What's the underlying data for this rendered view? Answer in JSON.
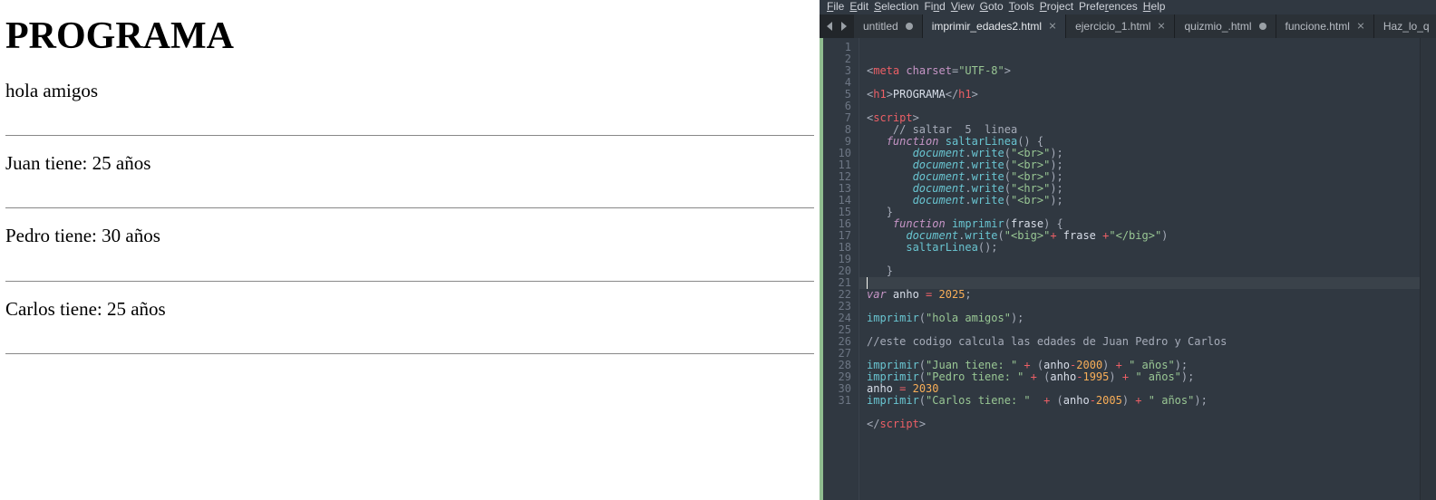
{
  "browser": {
    "heading": "PROGRAMA",
    "lines": [
      "hola amigos",
      "Juan tiene: 25 años",
      "Pedro tiene: 30 años",
      "Carlos tiene: 25 años"
    ]
  },
  "editor": {
    "menu": [
      "File",
      "Edit",
      "Selection",
      "Find",
      "View",
      "Goto",
      "Tools",
      "Project",
      "Preferences",
      "Help"
    ],
    "tabs": [
      {
        "label": "untitled",
        "dirty": true,
        "active": false
      },
      {
        "label": "imprimir_edades2.html",
        "dirty": false,
        "active": true
      },
      {
        "label": "ejercicio_1.html",
        "dirty": false,
        "active": false
      },
      {
        "label": "quizmio_.html",
        "dirty": true,
        "active": false
      },
      {
        "label": "funcione.html",
        "dirty": false,
        "active": false
      },
      {
        "label": "Haz_lo_q",
        "dirty": false,
        "active": false
      }
    ],
    "line_count": 31,
    "active_line": 21,
    "code_lines": [
      {
        "n": 1,
        "t": [
          [
            "pun",
            "<"
          ],
          [
            "tag",
            "meta"
          ],
          [
            "txt",
            " "
          ],
          [
            "attr",
            "charset"
          ],
          [
            "pun",
            "="
          ],
          [
            "str",
            "\"UTF-8\""
          ],
          [
            "pun",
            ">"
          ]
        ]
      },
      {
        "n": 2,
        "t": []
      },
      {
        "n": 3,
        "t": [
          [
            "pun",
            "<"
          ],
          [
            "tag",
            "h1"
          ],
          [
            "pun",
            ">"
          ],
          [
            "txt",
            "PROGRAMA"
          ],
          [
            "pun",
            "</"
          ],
          [
            "tag",
            "h1"
          ],
          [
            "pun",
            ">"
          ]
        ]
      },
      {
        "n": 4,
        "t": []
      },
      {
        "n": 5,
        "t": [
          [
            "pun",
            "<"
          ],
          [
            "tag",
            "script"
          ],
          [
            "pun",
            ">"
          ]
        ]
      },
      {
        "n": 6,
        "t": [
          [
            "txt",
            "    "
          ],
          [
            "cm",
            "// saltar  5  linea"
          ]
        ]
      },
      {
        "n": 7,
        "t": [
          [
            "txt",
            "   "
          ],
          [
            "kw",
            "function"
          ],
          [
            "txt",
            " "
          ],
          [
            "fn",
            "saltarLinea"
          ],
          [
            "pun",
            "() {"
          ]
        ]
      },
      {
        "n": 8,
        "t": [
          [
            "txt",
            "       "
          ],
          [
            "obj",
            "document"
          ],
          [
            "pun",
            "."
          ],
          [
            "fn",
            "write"
          ],
          [
            "pun",
            "("
          ],
          [
            "str",
            "\"<br>\""
          ],
          [
            "pun",
            ");"
          ]
        ]
      },
      {
        "n": 9,
        "t": [
          [
            "txt",
            "       "
          ],
          [
            "obj",
            "document"
          ],
          [
            "pun",
            "."
          ],
          [
            "fn",
            "write"
          ],
          [
            "pun",
            "("
          ],
          [
            "str",
            "\"<br>\""
          ],
          [
            "pun",
            ");"
          ]
        ]
      },
      {
        "n": 10,
        "t": [
          [
            "txt",
            "       "
          ],
          [
            "obj",
            "document"
          ],
          [
            "pun",
            "."
          ],
          [
            "fn",
            "write"
          ],
          [
            "pun",
            "("
          ],
          [
            "str",
            "\"<br>\""
          ],
          [
            "pun",
            ");"
          ]
        ]
      },
      {
        "n": 11,
        "t": [
          [
            "txt",
            "       "
          ],
          [
            "obj",
            "document"
          ],
          [
            "pun",
            "."
          ],
          [
            "fn",
            "write"
          ],
          [
            "pun",
            "("
          ],
          [
            "str",
            "\"<hr>\""
          ],
          [
            "pun",
            ");"
          ]
        ]
      },
      {
        "n": 12,
        "t": [
          [
            "txt",
            "       "
          ],
          [
            "obj",
            "document"
          ],
          [
            "pun",
            "."
          ],
          [
            "fn",
            "write"
          ],
          [
            "pun",
            "("
          ],
          [
            "str",
            "\"<br>\""
          ],
          [
            "pun",
            ");"
          ]
        ]
      },
      {
        "n": 13,
        "t": [
          [
            "txt",
            "   "
          ],
          [
            "pun",
            "}"
          ]
        ]
      },
      {
        "n": 14,
        "t": [
          [
            "txt",
            "    "
          ],
          [
            "kw",
            "function"
          ],
          [
            "txt",
            " "
          ],
          [
            "fn",
            "imprimir"
          ],
          [
            "pun",
            "("
          ],
          [
            "var",
            "frase"
          ],
          [
            "pun",
            ") {"
          ]
        ]
      },
      {
        "n": 15,
        "t": [
          [
            "txt",
            "      "
          ],
          [
            "obj",
            "document"
          ],
          [
            "pun",
            "."
          ],
          [
            "fn",
            "write"
          ],
          [
            "pun",
            "("
          ],
          [
            "str",
            "\"<big>\""
          ],
          [
            "op",
            "+"
          ],
          [
            "txt",
            " frase "
          ],
          [
            "op",
            "+"
          ],
          [
            "str",
            "\"</big>\""
          ],
          [
            "pun",
            ")"
          ]
        ]
      },
      {
        "n": 16,
        "t": [
          [
            "txt",
            "      "
          ],
          [
            "fn",
            "saltarLinea"
          ],
          [
            "pun",
            "();"
          ]
        ]
      },
      {
        "n": 17,
        "t": []
      },
      {
        "n": 18,
        "t": [
          [
            "txt",
            "   "
          ],
          [
            "pun",
            "}"
          ]
        ]
      },
      {
        "n": 19,
        "t": []
      },
      {
        "n": 20,
        "t": [
          [
            "kw",
            "var"
          ],
          [
            "txt",
            " anho "
          ],
          [
            "op",
            "="
          ],
          [
            "txt",
            " "
          ],
          [
            "num",
            "2025"
          ],
          [
            "pun",
            ";"
          ]
        ]
      },
      {
        "n": 21,
        "t": []
      },
      {
        "n": 22,
        "t": [
          [
            "fn",
            "imprimir"
          ],
          [
            "pun",
            "("
          ],
          [
            "str",
            "\"hola amigos\""
          ],
          [
            "pun",
            ");"
          ]
        ]
      },
      {
        "n": 23,
        "t": []
      },
      {
        "n": 24,
        "t": [
          [
            "cm",
            "//este codigo calcula las edades de Juan Pedro y Carlos"
          ]
        ]
      },
      {
        "n": 25,
        "t": []
      },
      {
        "n": 26,
        "t": [
          [
            "fn",
            "imprimir"
          ],
          [
            "pun",
            "("
          ],
          [
            "str",
            "\"Juan tiene: \""
          ],
          [
            "txt",
            " "
          ],
          [
            "op",
            "+"
          ],
          [
            "txt",
            " "
          ],
          [
            "pun",
            "("
          ],
          [
            "txt",
            "anho"
          ],
          [
            "op",
            "-"
          ],
          [
            "num",
            "2000"
          ],
          [
            "pun",
            ")"
          ],
          [
            "txt",
            " "
          ],
          [
            "op",
            "+"
          ],
          [
            "txt",
            " "
          ],
          [
            "str",
            "\" años\""
          ],
          [
            "pun",
            ");"
          ]
        ]
      },
      {
        "n": 27,
        "t": [
          [
            "fn",
            "imprimir"
          ],
          [
            "pun",
            "("
          ],
          [
            "str",
            "\"Pedro tiene: \""
          ],
          [
            "txt",
            " "
          ],
          [
            "op",
            "+"
          ],
          [
            "txt",
            " "
          ],
          [
            "pun",
            "("
          ],
          [
            "txt",
            "anho"
          ],
          [
            "op",
            "-"
          ],
          [
            "num",
            "1995"
          ],
          [
            "pun",
            ")"
          ],
          [
            "txt",
            " "
          ],
          [
            "op",
            "+"
          ],
          [
            "txt",
            " "
          ],
          [
            "str",
            "\" años\""
          ],
          [
            "pun",
            ");"
          ]
        ]
      },
      {
        "n": 28,
        "t": [
          [
            "txt",
            "anho "
          ],
          [
            "op",
            "="
          ],
          [
            "txt",
            " "
          ],
          [
            "num",
            "2030"
          ]
        ]
      },
      {
        "n": 29,
        "t": [
          [
            "fn",
            "imprimir"
          ],
          [
            "pun",
            "("
          ],
          [
            "str",
            "\"Carlos tiene: \""
          ],
          [
            "txt",
            "  "
          ],
          [
            "op",
            "+"
          ],
          [
            "txt",
            " "
          ],
          [
            "pun",
            "("
          ],
          [
            "txt",
            "anho"
          ],
          [
            "op",
            "-"
          ],
          [
            "num",
            "2005"
          ],
          [
            "pun",
            ")"
          ],
          [
            "txt",
            " "
          ],
          [
            "op",
            "+"
          ],
          [
            "txt",
            " "
          ],
          [
            "str",
            "\" años\""
          ],
          [
            "pun",
            ");"
          ]
        ]
      },
      {
        "n": 30,
        "t": []
      },
      {
        "n": 31,
        "t": [
          [
            "pun",
            "</"
          ],
          [
            "tag",
            "script"
          ],
          [
            "pun",
            ">"
          ]
        ]
      }
    ]
  }
}
